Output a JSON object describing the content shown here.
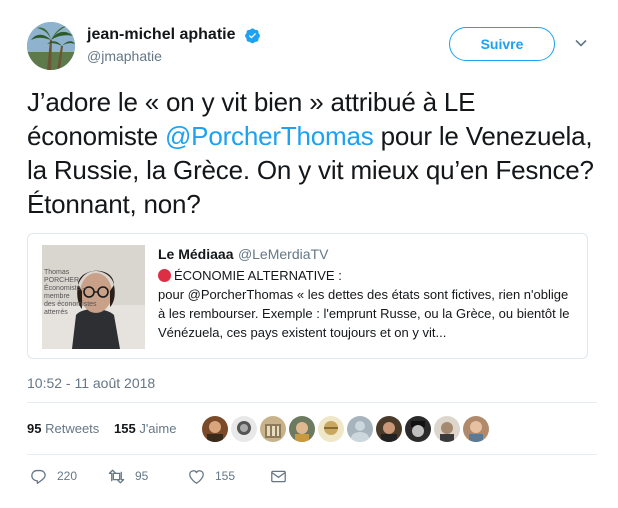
{
  "author": {
    "display_name": "jean-michel aphatie",
    "handle": "@jmaphatie",
    "avatar_icon": "avatar-palm-trees"
  },
  "follow_label": "Suivre",
  "tweet": {
    "text_before": "J’adore le « on y vit bien » attribué à LE économiste ",
    "mention": "@PorcherThomas",
    "text_after": " pour le Venezuela, la Russie, la Grèce. On y vit mieux qu’en Fesnce? Étonnant, non?"
  },
  "quote": {
    "name": "Le Médiaaa",
    "handle": "@LeMerdiaTV",
    "headline": "ÉCONOMIE ALTERNATIVE :",
    "body": "pour @PorcherThomas « les dettes des états sont fictives, rien n'oblige à les rembourser. Exemple : l'emprunt Russe, ou la Grèce, ou bientôt le Vénézuela, ces pays existent toujours et on y vit...",
    "image_caption_line1": "Thomas PORCHER",
    "image_caption_line2": "Économiste – membre",
    "image_caption_line3": "des économistes atterrés"
  },
  "timestamp": "10:52 - 11 août 2018",
  "stats": {
    "retweets_count": "95",
    "retweets_label": "Retweets",
    "likes_count": "155",
    "likes_label": "J'aime"
  },
  "likers_avatars": [
    "avatar-1",
    "avatar-2",
    "avatar-3",
    "avatar-4",
    "avatar-5",
    "avatar-6",
    "avatar-7",
    "avatar-8",
    "avatar-9",
    "avatar-10"
  ],
  "actions": {
    "reply_count": "220",
    "retweet_count": "95",
    "like_count": "155"
  },
  "colors": {
    "accent": "#1da1f2",
    "muted": "#657786",
    "red_dot": "#dd2e44"
  }
}
